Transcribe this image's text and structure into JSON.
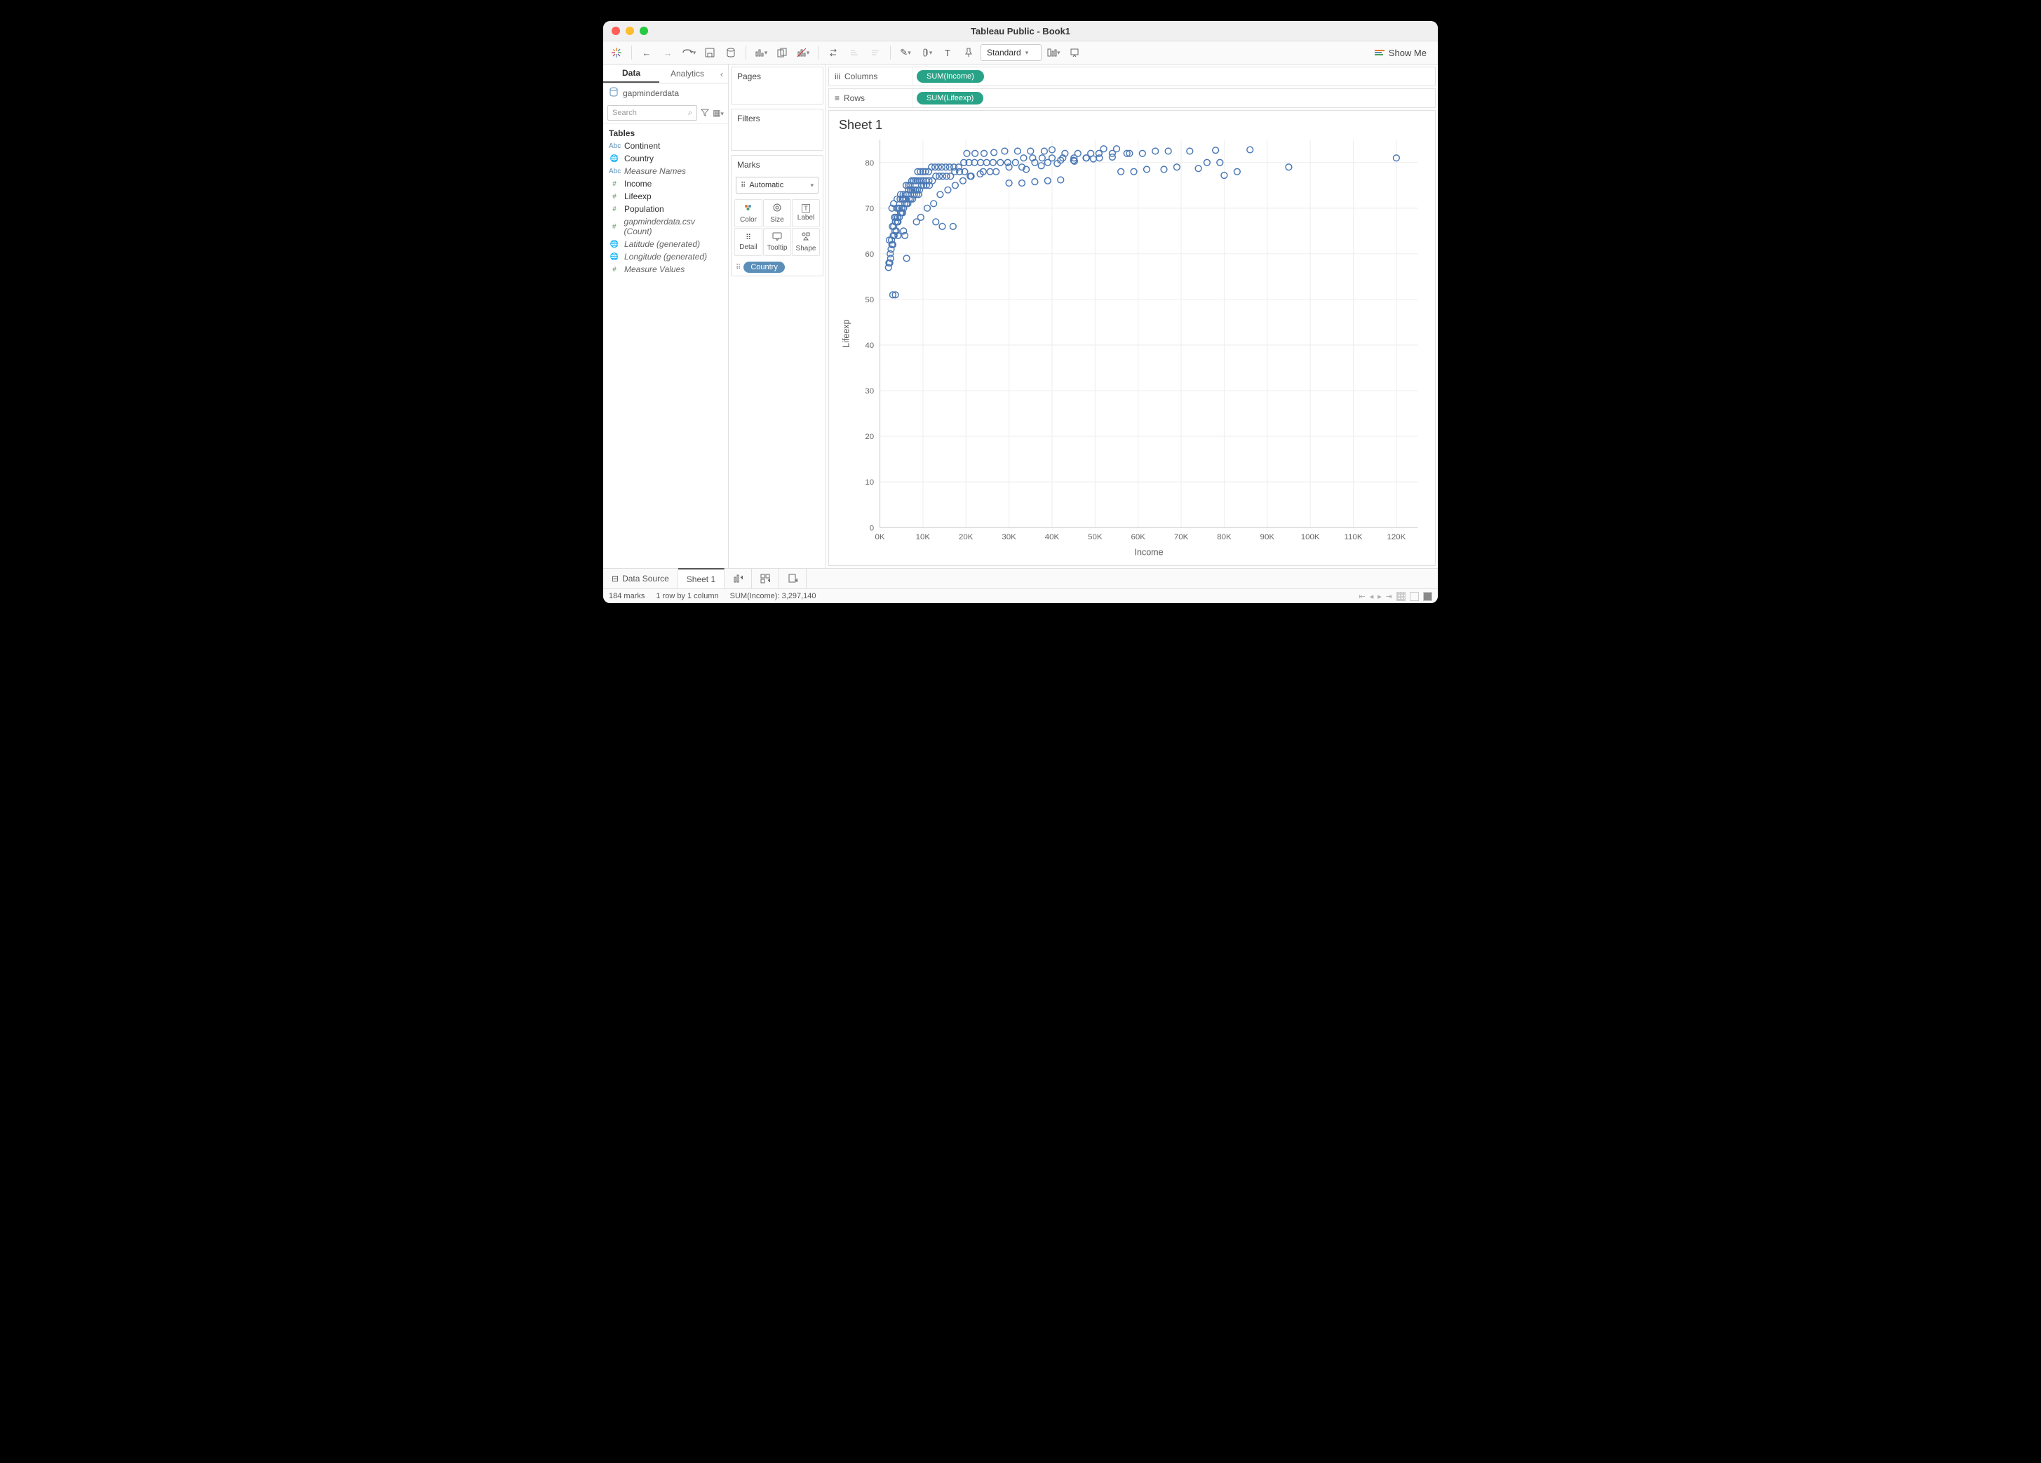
{
  "window": {
    "title": "Tableau Public - Book1"
  },
  "toolbar": {
    "fit_mode": "Standard",
    "showme": "Show Me"
  },
  "sidebar": {
    "tabs": {
      "data": "Data",
      "analytics": "Analytics"
    },
    "datasource": "gapminderdata",
    "search_placeholder": "Search",
    "tables_label": "Tables",
    "fields": [
      {
        "type": "Abc",
        "name": "Continent",
        "kind": "dim"
      },
      {
        "type": "🌐",
        "name": "Country",
        "kind": "globe"
      },
      {
        "type": "Abc",
        "name": "Measure Names",
        "kind": "dim",
        "italic": true
      },
      {
        "type": "#",
        "name": "Income",
        "kind": "num"
      },
      {
        "type": "#",
        "name": "Lifeexp",
        "kind": "num"
      },
      {
        "type": "#",
        "name": "Population",
        "kind": "num"
      },
      {
        "type": "#",
        "name": "gapminderdata.csv (Count)",
        "kind": "num",
        "italic": true
      },
      {
        "type": "🌐",
        "name": "Latitude (generated)",
        "kind": "globe",
        "italic": true
      },
      {
        "type": "🌐",
        "name": "Longitude (generated)",
        "kind": "globe",
        "italic": true
      },
      {
        "type": "#",
        "name": "Measure Values",
        "kind": "num",
        "italic": true
      }
    ]
  },
  "cards": {
    "pages": "Pages",
    "filters": "Filters",
    "marks": "Marks",
    "marks_type": "Automatic",
    "mark_cells": [
      "Color",
      "Size",
      "Label",
      "Detail",
      "Tooltip",
      "Shape"
    ],
    "marks_pill": "Country"
  },
  "shelves": {
    "columns_label": "Columns",
    "rows_label": "Rows",
    "columns_pill": "SUM(Income)",
    "rows_pill": "SUM(Lifeexp)"
  },
  "viz": {
    "title": "Sheet 1",
    "xlabel": "Income",
    "ylabel": "Lifeexp"
  },
  "bottom": {
    "datasource": "Data Source",
    "sheet": "Sheet 1"
  },
  "status": {
    "marks": "184 marks",
    "dims": "1 row by 1 column",
    "sum": "SUM(Income): 3,297,140"
  },
  "chart_data": {
    "type": "scatter",
    "title": "Sheet 1",
    "xlabel": "Income",
    "ylabel": "Lifeexp",
    "xlim": [
      0,
      125000
    ],
    "ylim": [
      0,
      85
    ],
    "xticks": [
      "0K",
      "10K",
      "20K",
      "30K",
      "40K",
      "50K",
      "60K",
      "70K",
      "80K",
      "90K",
      "100K",
      "110K",
      "120K"
    ],
    "yticks": [
      0,
      10,
      20,
      30,
      40,
      50,
      60,
      70,
      80
    ],
    "points": [
      [
        2000,
        57
      ],
      [
        2100,
        58
      ],
      [
        2300,
        58
      ],
      [
        2500,
        59
      ],
      [
        2400,
        60
      ],
      [
        2600,
        61
      ],
      [
        2800,
        62
      ],
      [
        3000,
        62
      ],
      [
        2200,
        63
      ],
      [
        2700,
        63
      ],
      [
        3100,
        64
      ],
      [
        3300,
        64
      ],
      [
        3500,
        65
      ],
      [
        3800,
        65
      ],
      [
        2900,
        66
      ],
      [
        3200,
        66
      ],
      [
        3600,
        67
      ],
      [
        4000,
        67
      ],
      [
        4200,
        67
      ],
      [
        3400,
        68
      ],
      [
        3700,
        68
      ],
      [
        4100,
        68
      ],
      [
        4500,
        68
      ],
      [
        4800,
        69
      ],
      [
        5000,
        69
      ],
      [
        5300,
        69
      ],
      [
        3900,
        70
      ],
      [
        4300,
        70
      ],
      [
        4600,
        70
      ],
      [
        5100,
        70
      ],
      [
        5500,
        70
      ],
      [
        5800,
        71
      ],
      [
        6200,
        71
      ],
      [
        6500,
        71
      ],
      [
        4700,
        72
      ],
      [
        5200,
        72
      ],
      [
        5600,
        72
      ],
      [
        6000,
        72
      ],
      [
        6800,
        72
      ],
      [
        7200,
        72
      ],
      [
        7600,
        72
      ],
      [
        8000,
        73
      ],
      [
        8500,
        73
      ],
      [
        9000,
        73
      ],
      [
        5400,
        73
      ],
      [
        5900,
        73
      ],
      [
        6300,
        73
      ],
      [
        6700,
        74
      ],
      [
        7100,
        74
      ],
      [
        7500,
        74
      ],
      [
        7900,
        74
      ],
      [
        8300,
        74
      ],
      [
        8700,
        74
      ],
      [
        9200,
        74
      ],
      [
        9700,
        75
      ],
      [
        10200,
        75
      ],
      [
        10800,
        75
      ],
      [
        11500,
        75
      ],
      [
        6100,
        75
      ],
      [
        6600,
        75
      ],
      [
        7000,
        75
      ],
      [
        7400,
        76
      ],
      [
        7800,
        76
      ],
      [
        8200,
        76
      ],
      [
        8600,
        76
      ],
      [
        9100,
        76
      ],
      [
        9600,
        76
      ],
      [
        10100,
        76
      ],
      [
        10700,
        76
      ],
      [
        11400,
        76
      ],
      [
        12200,
        76
      ],
      [
        13000,
        77
      ],
      [
        13800,
        77
      ],
      [
        14600,
        77
      ],
      [
        15500,
        77
      ],
      [
        16400,
        77
      ],
      [
        17400,
        78
      ],
      [
        18500,
        78
      ],
      [
        19700,
        78
      ],
      [
        8800,
        78
      ],
      [
        9400,
        78
      ],
      [
        10000,
        78
      ],
      [
        10600,
        78
      ],
      [
        11300,
        78
      ],
      [
        12000,
        79
      ],
      [
        12800,
        79
      ],
      [
        13600,
        79
      ],
      [
        14400,
        79
      ],
      [
        15300,
        79
      ],
      [
        16200,
        79
      ],
      [
        17200,
        79
      ],
      [
        18300,
        79
      ],
      [
        19500,
        80
      ],
      [
        20700,
        80
      ],
      [
        22000,
        80
      ],
      [
        23400,
        80
      ],
      [
        24800,
        80
      ],
      [
        26300,
        80
      ],
      [
        28000,
        80
      ],
      [
        29700,
        80
      ],
      [
        31500,
        80
      ],
      [
        33400,
        81
      ],
      [
        35500,
        81
      ],
      [
        37700,
        81
      ],
      [
        40000,
        81
      ],
      [
        42500,
        81
      ],
      [
        45100,
        81
      ],
      [
        47900,
        81
      ],
      [
        50900,
        82
      ],
      [
        54000,
        82
      ],
      [
        57400,
        82
      ],
      [
        38200,
        82.5
      ],
      [
        35000,
        82.5
      ],
      [
        32000,
        82.5
      ],
      [
        29000,
        82.5
      ],
      [
        26500,
        82.2
      ],
      [
        24200,
        82
      ],
      [
        22100,
        82
      ],
      [
        20200,
        82
      ],
      [
        43000,
        82
      ],
      [
        46000,
        82
      ],
      [
        49000,
        82
      ],
      [
        40000,
        82.8
      ],
      [
        17000,
        66
      ],
      [
        14500,
        66
      ],
      [
        13000,
        67
      ],
      [
        21000,
        77
      ],
      [
        24000,
        78
      ],
      [
        27000,
        78
      ],
      [
        30000,
        79
      ],
      [
        33000,
        79
      ],
      [
        36000,
        80
      ],
      [
        39000,
        80
      ],
      [
        42000,
        80.5
      ],
      [
        45000,
        80.5
      ],
      [
        48000,
        81
      ],
      [
        51000,
        81
      ],
      [
        54000,
        81.2
      ],
      [
        52000,
        83
      ],
      [
        55000,
        83
      ],
      [
        58000,
        82
      ],
      [
        61000,
        82
      ],
      [
        56000,
        78
      ],
      [
        59000,
        78
      ],
      [
        62000,
        78.5
      ],
      [
        64000,
        82.5
      ],
      [
        67000,
        82.5
      ],
      [
        66000,
        78.5
      ],
      [
        69000,
        79
      ],
      [
        72000,
        82.5
      ],
      [
        74000,
        78.7
      ],
      [
        76000,
        80
      ],
      [
        79000,
        80
      ],
      [
        78000,
        82.7
      ],
      [
        86000,
        82.8
      ],
      [
        83000,
        78
      ],
      [
        80000,
        77.2
      ],
      [
        95000,
        79
      ],
      [
        120000,
        81
      ],
      [
        3000,
        51
      ],
      [
        3600,
        51
      ],
      [
        6200,
        59
      ],
      [
        30000,
        75.5
      ],
      [
        33000,
        75.5
      ],
      [
        36000,
        75.8
      ],
      [
        39000,
        76
      ],
      [
        42000,
        76.2
      ],
      [
        5500,
        65
      ],
      [
        2800,
        70
      ],
      [
        4200,
        64
      ],
      [
        5800,
        64
      ],
      [
        8500,
        67
      ],
      [
        9500,
        68
      ],
      [
        3200,
        71
      ],
      [
        4000,
        72
      ],
      [
        4800,
        73
      ],
      [
        11000,
        70
      ],
      [
        12500,
        71
      ],
      [
        14000,
        73
      ],
      [
        15800,
        74
      ],
      [
        17500,
        75
      ],
      [
        19300,
        76
      ],
      [
        21200,
        77
      ],
      [
        23300,
        77.5
      ],
      [
        25600,
        78
      ],
      [
        34000,
        78.5
      ],
      [
        37500,
        79.3
      ],
      [
        41200,
        79.8
      ],
      [
        45200,
        80.3
      ],
      [
        49600,
        80.8
      ]
    ]
  }
}
